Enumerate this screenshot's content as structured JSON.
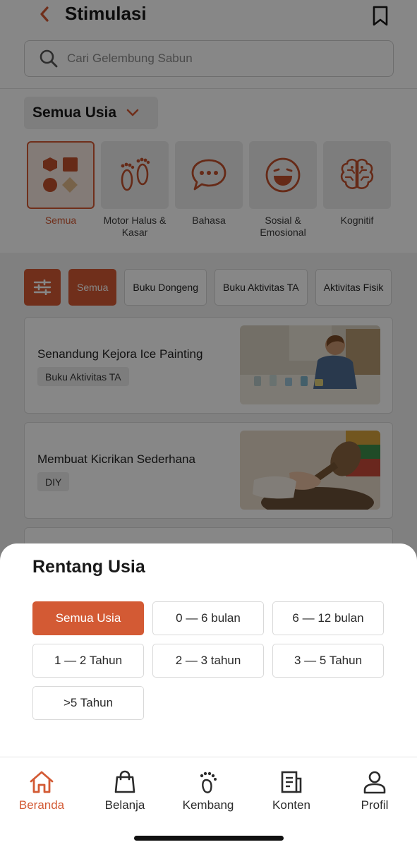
{
  "header": {
    "title": "Stimulasi"
  },
  "search": {
    "placeholder": "Cari Gelembung Sabun"
  },
  "age_filter": {
    "selected": "Semua Usia"
  },
  "categories": [
    {
      "label": "Semua",
      "icon": "shapes-icon",
      "active": true
    },
    {
      "label": "Motor Halus & Kasar",
      "icon": "footprints-icon"
    },
    {
      "label": "Bahasa",
      "icon": "speech-bubble-icon"
    },
    {
      "label": "Sosial & Emosional",
      "icon": "laughing-face-icon"
    },
    {
      "label": "Kognitif",
      "icon": "brain-icon"
    }
  ],
  "filter_chips": [
    {
      "label": "Semua",
      "active": true
    },
    {
      "label": "Buku Dongeng"
    },
    {
      "label": "Buku Aktivitas TA"
    },
    {
      "label": "Aktivitas Fisik"
    }
  ],
  "cards": [
    {
      "title": "Senandung Kejora Ice Painting",
      "tag": "Buku Aktivitas TA"
    },
    {
      "title": "Membuat Kicrikan Sederhana",
      "tag": "DIY"
    }
  ],
  "sheet": {
    "title": "Rentang Usia",
    "options": [
      "Semua Usia",
      "0 — 6 bulan",
      "6 — 12 bulan",
      "1 — 2 Tahun",
      "2 — 3 tahun",
      "3 — 5 Tahun",
      ">5 Tahun"
    ],
    "selected": "Semua Usia"
  },
  "nav": [
    {
      "label": "Beranda",
      "icon": "home-icon",
      "active": true
    },
    {
      "label": "Belanja",
      "icon": "shopping-bag-icon"
    },
    {
      "label": "Kembang",
      "icon": "footprint-icon"
    },
    {
      "label": "Konten",
      "icon": "document-icon"
    },
    {
      "label": "Profil",
      "icon": "user-icon"
    }
  ],
  "colors": {
    "accent": "#d35a34",
    "overlay": "#000000"
  }
}
